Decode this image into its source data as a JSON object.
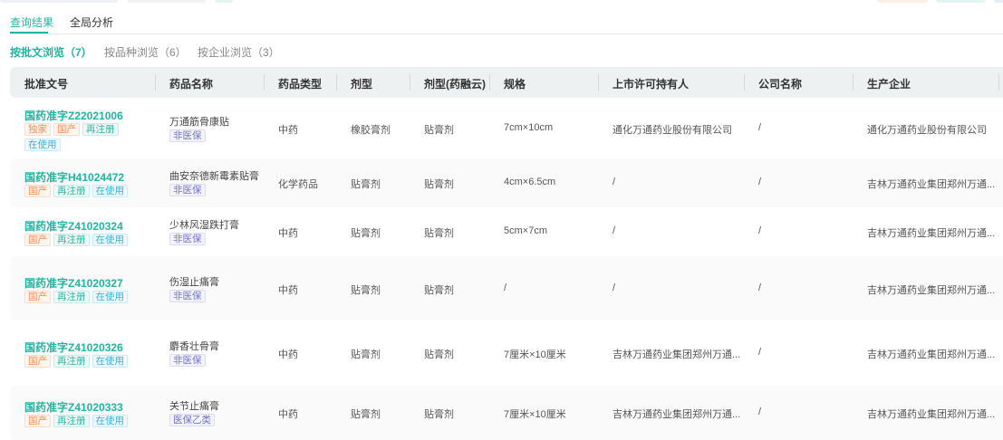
{
  "tabs": {
    "results": "查询结果",
    "analysis": "全局分析"
  },
  "subtabs": {
    "by_approval": "按批文浏览（7）",
    "by_variety": "按品种浏览（6）",
    "by_company": "按企业浏览（3）"
  },
  "columns": [
    "批准文号",
    "药品名称",
    "药品类型",
    "剂型",
    "剂型(药融云)",
    "规格",
    "上市许可持有人",
    "公司名称",
    "生产企业"
  ],
  "rows": [
    {
      "code": "国药准字Z22021006",
      "tags": [
        "独家",
        "国产",
        "再注册",
        "在使用"
      ],
      "name": "万通筋骨康贴",
      "insurance": "非医保",
      "type": "中药",
      "form": "橡胶膏剂",
      "form2": "贴膏剂",
      "spec": "7cm×10cm",
      "holder": "通化万通药业股份有限公司",
      "company": "/",
      "maker": "通化万通药业股份有限公司"
    },
    {
      "code": "国药准字H41024472",
      "tags": [
        "国产",
        "再注册",
        "在使用"
      ],
      "name": "曲安奈德新霉素贴膏",
      "insurance": "非医保",
      "type": "化学药品",
      "form": "贴膏剂",
      "form2": "贴膏剂",
      "spec": "4cm×6.5cm",
      "holder": "/",
      "company": "/",
      "maker": "吉林万通药业集团郑州万通..."
    },
    {
      "code": "国药准字Z41020324",
      "tags": [
        "国产",
        "再注册",
        "在使用"
      ],
      "name": "少林风湿跌打膏",
      "insurance": "非医保",
      "type": "中药",
      "form": "贴膏剂",
      "form2": "贴膏剂",
      "spec": "5cm×7cm",
      "holder": "/",
      "company": "/",
      "maker": "吉林万通药业集团郑州万通..."
    },
    {
      "code": "国药准字Z41020327",
      "tags": [
        "国产",
        "再注册",
        "在使用"
      ],
      "name": "伤湿止痛膏",
      "insurance": "非医保",
      "type": "中药",
      "form": "贴膏剂",
      "form2": "贴膏剂",
      "spec": "/",
      "holder": "/",
      "company": "/",
      "maker": "吉林万通药业集团郑州万通..."
    },
    {
      "code": "国药准字Z41020326",
      "tags": [
        "国产",
        "再注册",
        "在使用"
      ],
      "name": "麝香壮骨膏",
      "insurance": "非医保",
      "type": "中药",
      "form": "贴膏剂",
      "form2": "贴膏剂",
      "spec": "7厘米×10厘米",
      "holder": "吉林万通药业集团郑州万通...",
      "company": "/",
      "maker": "吉林万通药业集团郑州万通..."
    },
    {
      "code": "国药准字Z41020333",
      "tags": [
        "国产",
        "再注册",
        "在使用"
      ],
      "name": "关节止痛膏",
      "insurance": "医保乙类",
      "type": "中药",
      "form": "贴膏剂",
      "form2": "贴膏剂",
      "spec": "7厘米×10厘米",
      "holder": "吉林万通药业集团郑州万通...",
      "company": "/",
      "maker": "吉林万通药业集团郑州万通..."
    }
  ],
  "colors": {
    "accent": "#1fb5a0"
  }
}
